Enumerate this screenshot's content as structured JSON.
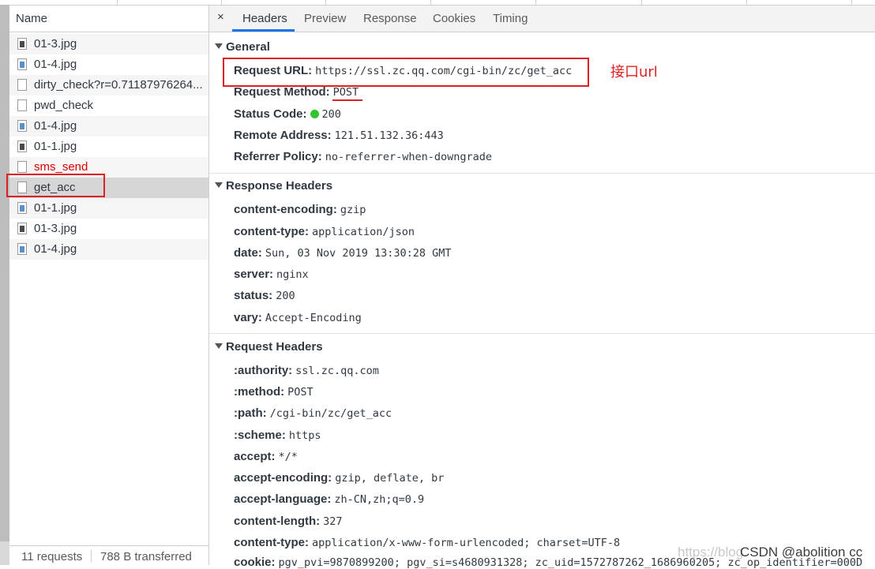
{
  "name_panel": {
    "header": "Name",
    "rows": [
      {
        "label": "01-3.jpg",
        "icon": "image-file-icon"
      },
      {
        "label": "01-4.jpg",
        "icon": "image-file-icon"
      },
      {
        "label": "dirty_check?r=0.71187976264...",
        "icon": "document-file-icon"
      },
      {
        "label": "pwd_check",
        "icon": "document-file-icon"
      },
      {
        "label": "01-4.jpg",
        "icon": "image-file-icon"
      },
      {
        "label": "01-1.jpg",
        "icon": "image-file-icon"
      },
      {
        "label": "sms_send",
        "icon": "document-file-icon",
        "status": "error"
      },
      {
        "label": "get_acc",
        "icon": "document-file-icon",
        "selected": true
      },
      {
        "label": "01-1.jpg",
        "icon": "image-file-icon"
      },
      {
        "label": "01-3.jpg",
        "icon": "image-file-icon"
      },
      {
        "label": "01-4.jpg",
        "icon": "image-file-icon"
      }
    ],
    "status": {
      "requests": "11 requests",
      "transferred": "788 B transferred"
    }
  },
  "tabs": {
    "close": "×",
    "items": [
      "Headers",
      "Preview",
      "Response",
      "Cookies",
      "Timing"
    ],
    "active": "Headers"
  },
  "general": {
    "title": "General",
    "request_url_key": "Request URL:",
    "request_url": "https://ssl.zc.qq.com/cgi-bin/zc/get_acc",
    "request_method_key": "Request Method:",
    "request_method": "POST",
    "status_code_key": "Status Code:",
    "status_code": "200",
    "remote_address_key": "Remote Address:",
    "remote_address": "121.51.132.36:443",
    "referrer_policy_key": "Referrer Policy:",
    "referrer_policy": "no-referrer-when-downgrade"
  },
  "response_headers": {
    "title": "Response Headers",
    "items": [
      {
        "k": "content-encoding:",
        "v": "gzip"
      },
      {
        "k": "content-type:",
        "v": "application/json"
      },
      {
        "k": "date:",
        "v": "Sun, 03 Nov 2019 13:30:28 GMT"
      },
      {
        "k": "server:",
        "v": "nginx"
      },
      {
        "k": "status:",
        "v": "200"
      },
      {
        "k": "vary:",
        "v": "Accept-Encoding"
      }
    ]
  },
  "request_headers": {
    "title": "Request Headers",
    "items": [
      {
        "k": ":authority:",
        "v": "ssl.zc.qq.com"
      },
      {
        "k": ":method:",
        "v": "POST"
      },
      {
        "k": ":path:",
        "v": "/cgi-bin/zc/get_acc"
      },
      {
        "k": ":scheme:",
        "v": "https"
      },
      {
        "k": "accept:",
        "v": "*/*"
      },
      {
        "k": "accept-encoding:",
        "v": "gzip, deflate, br"
      },
      {
        "k": "accept-language:",
        "v": "zh-CN,zh;q=0.9"
      },
      {
        "k": "content-length:",
        "v": "327"
      },
      {
        "k": "content-type:",
        "v": "application/x-www-form-urlencoded; charset=UTF-8"
      },
      {
        "k": "cookie:",
        "v": "pgv_pvi=9870899200; pgv_si=s4680931328; zc_uid=1572787262_1686960205; zc_op_identifier=000D"
      }
    ]
  },
  "annotation": "接口url",
  "watermark": "CSDN @abolition cc",
  "watermark_faint": "https://blog.",
  "colors": {
    "highlight": "#e02020",
    "accent": "#1a73e8",
    "error": "#dd0000",
    "status_ok": "#2ec52e"
  }
}
